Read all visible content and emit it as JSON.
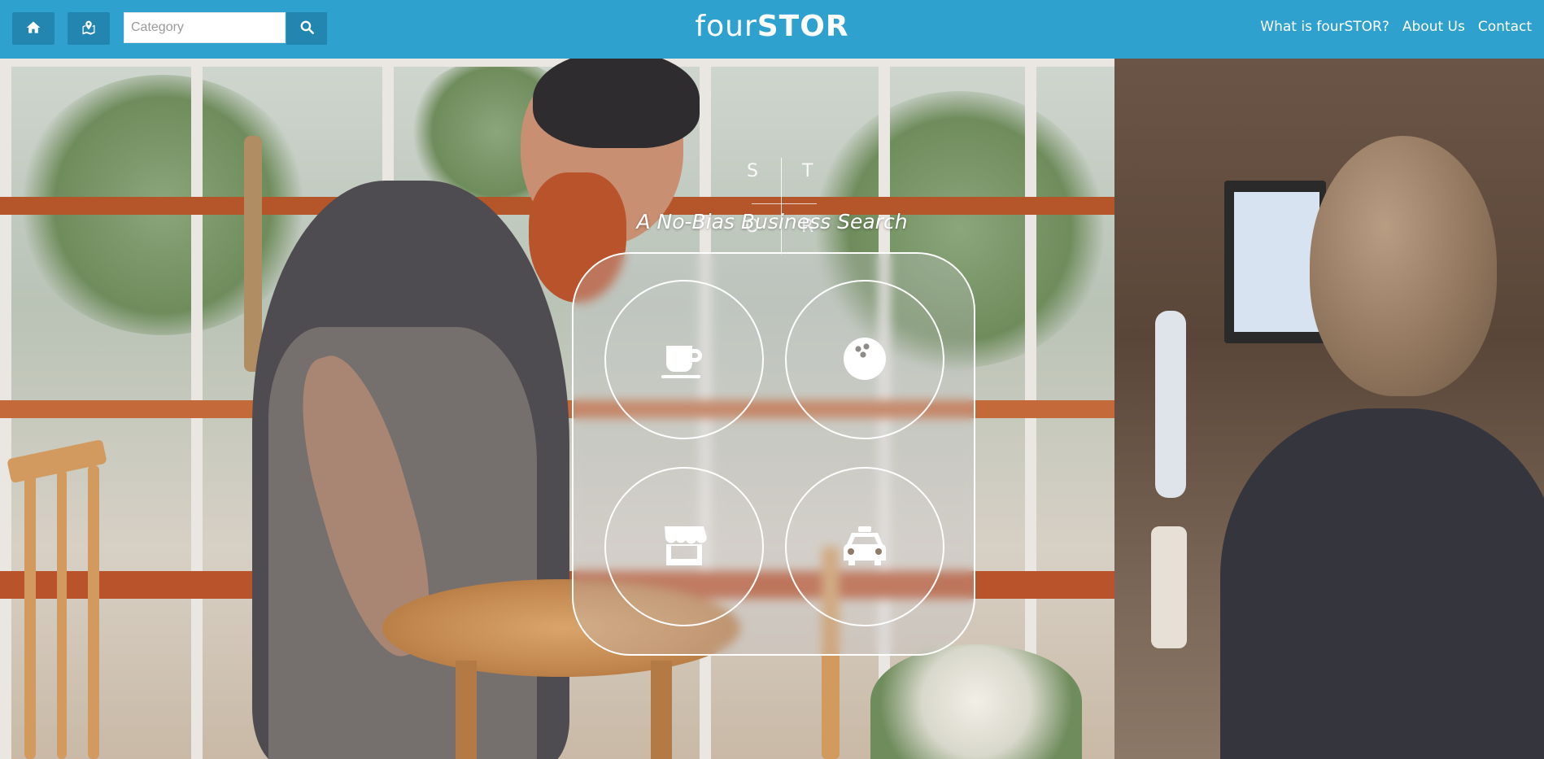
{
  "header": {
    "home_icon": "home-icon",
    "map_icon": "map-icon",
    "search": {
      "placeholder": "Category",
      "value": ""
    },
    "search_icon": "search-icon",
    "brand": {
      "light": "four",
      "bold": "STOR"
    },
    "nav": [
      {
        "label": "What is fourSTOR?"
      },
      {
        "label": "About Us"
      },
      {
        "label": "Contact"
      }
    ]
  },
  "hero": {
    "logo_letters": [
      "S",
      "T",
      "O",
      "R"
    ],
    "tagline": "A No-Bias Business Search",
    "categories": [
      {
        "icon": "coffee-cup-icon"
      },
      {
        "icon": "bowling-ball-icon"
      },
      {
        "icon": "storefront-icon"
      },
      {
        "icon": "taxi-icon"
      }
    ]
  },
  "colors": {
    "header_bg": "#2ea1cf",
    "header_button_bg": "#2286b0",
    "text_light": "#ffffff"
  }
}
